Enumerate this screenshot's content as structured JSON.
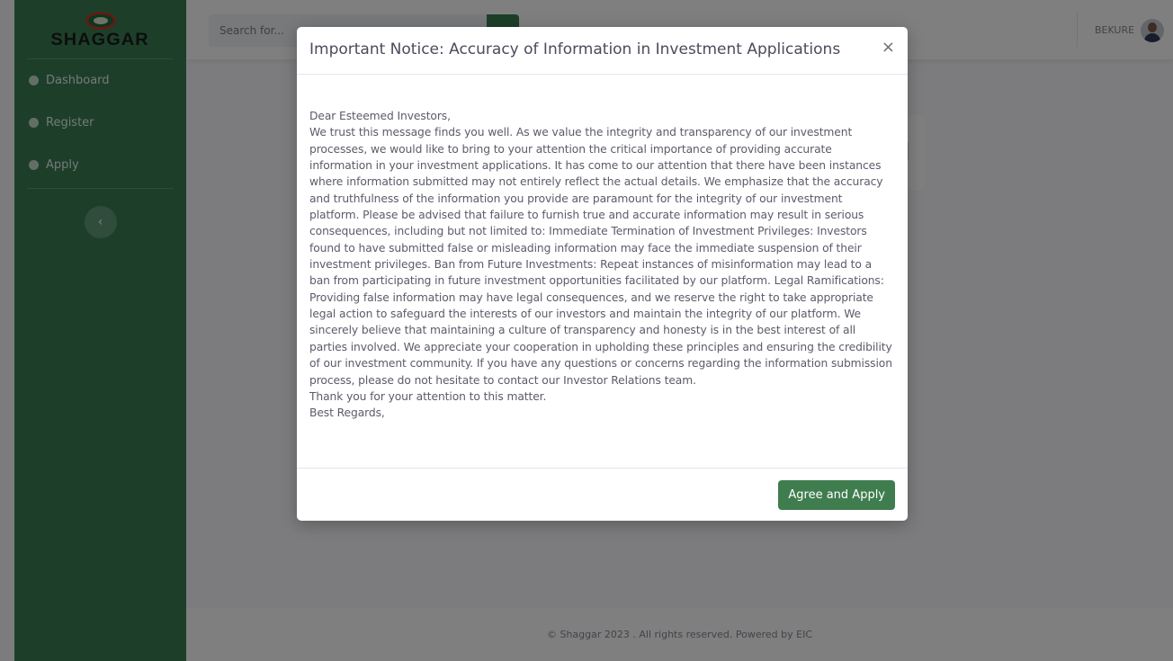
{
  "brand": {
    "name": "SHAGGAR"
  },
  "sidebar": {
    "items": [
      {
        "label": "Dashboard",
        "icon": "dashboard-icon"
      },
      {
        "label": "Register",
        "icon": "register-icon"
      },
      {
        "label": "Apply",
        "icon": "apply-icon"
      }
    ],
    "toggle_icon": "‹"
  },
  "topbar": {
    "search_placeholder": "Search for...",
    "search_icon": "⌕",
    "user_name": "BEKURE"
  },
  "footer": {
    "text": "© Shaggar 2023 . All rights reserved. Powered by EIC"
  },
  "modal": {
    "title": "Important Notice: Accuracy of Information in Investment Applications",
    "close_symbol": "×",
    "greeting": "Dear Esteemed Investors,",
    "body": "We trust this message finds you well. As we value the integrity and transparency of our investment processes, we would like to bring to your attention the critical importance of providing accurate information in your investment applications. It has come to our attention that there have been instances where information submitted may not entirely reflect the actual details. We emphasize that the accuracy and truthfulness of the information you provide are paramount for the integrity of our investment platform. Please be advised that failure to furnish true and accurate information may result in serious consequences, including but not limited to: Immediate Termination of Investment Privileges: Investors found to have submitted false or misleading information may face the immediate suspension of their investment privileges. Ban from Future Investments: Repeat instances of misinformation may lead to a ban from participating in future investment opportunities facilitated by our platform. Legal Ramifications: Providing false information may have legal consequences, and we reserve the right to take appropriate legal action to safeguard the interests of our investors and maintain the integrity of our platform. We sincerely believe that maintaining a culture of transparency and honesty is in the best interest of all parties involved. We appreciate your cooperation in upholding these principles and ensuring the credibility of our investment community. If you have any questions or concerns regarding the information submission process, please do not hesitate to contact our Investor Relations team.",
    "thanks": "Thank you for your attention to this matter.",
    "closing": "Best Regards,",
    "agree_label": "Agree and Apply"
  },
  "colors": {
    "sidebar": "#3a7f54",
    "primary_button": "#3f7d4f",
    "backdrop": "rgba(0,0,0,0.5)"
  }
}
